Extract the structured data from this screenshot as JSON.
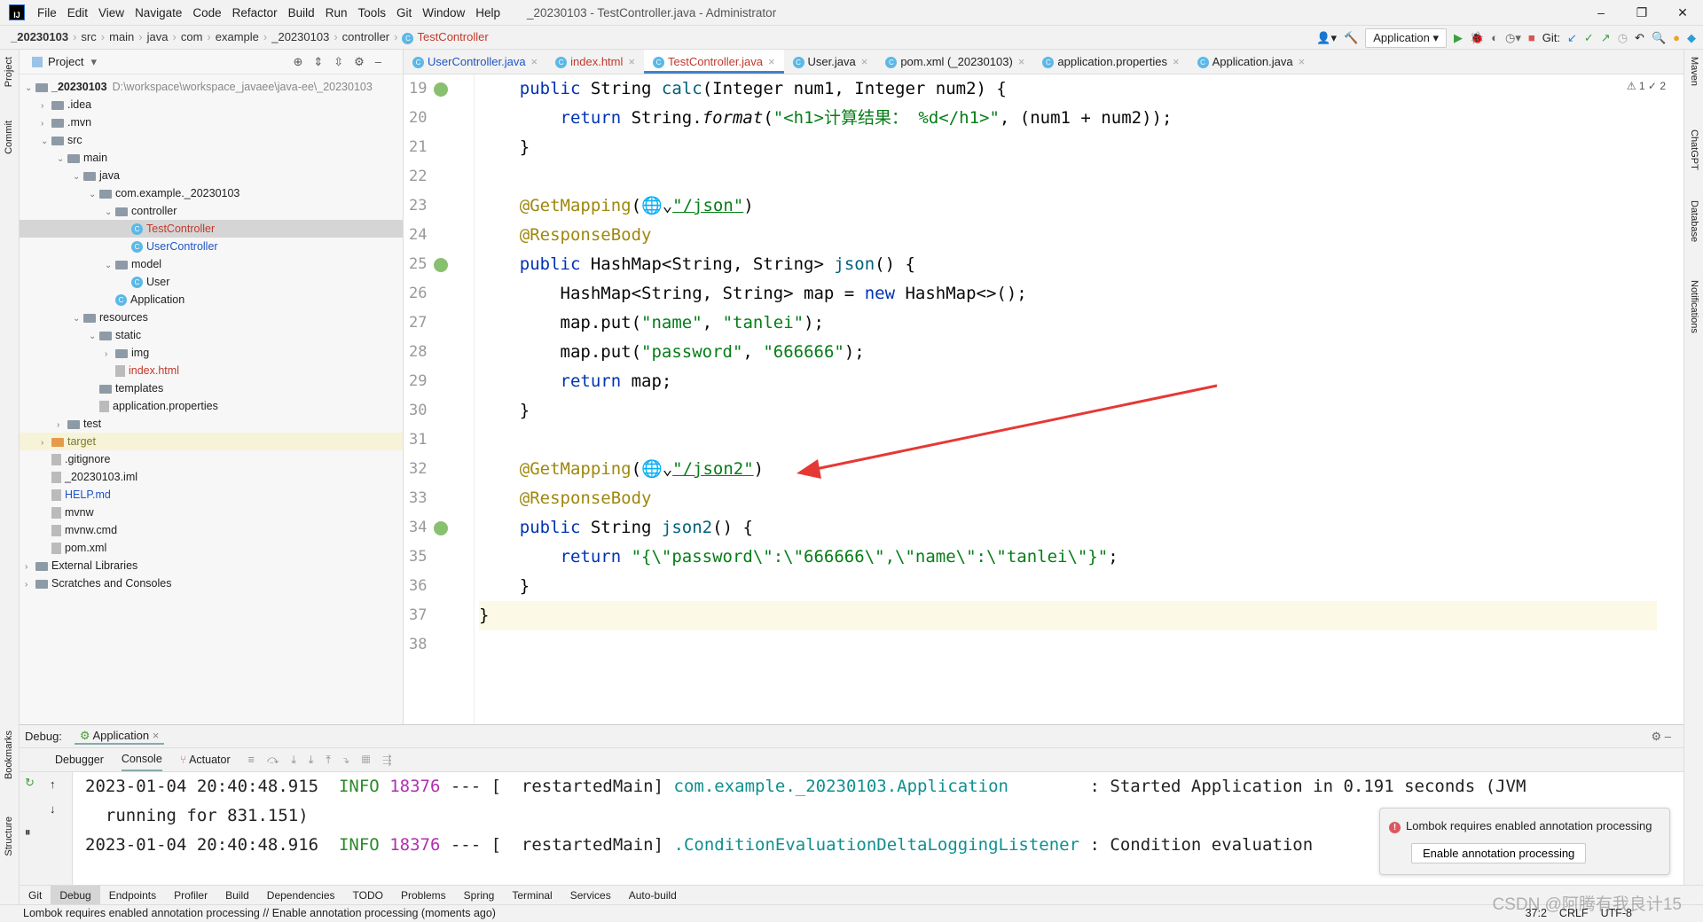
{
  "menu": [
    "File",
    "Edit",
    "View",
    "Navigate",
    "Code",
    "Refactor",
    "Build",
    "Run",
    "Tools",
    "Git",
    "Window",
    "Help"
  ],
  "window_title": "_20230103 - TestController.java - Administrator",
  "breadcrumb": [
    "_20230103",
    "src",
    "main",
    "java",
    "com",
    "example",
    "_20230103",
    "controller",
    "TestController"
  ],
  "toolbar": {
    "run_config": "Application",
    "git_label": "Git:"
  },
  "project": {
    "title": "Project",
    "tree": [
      {
        "d": 0,
        "a": "v",
        "t": "_20230103",
        "extra": "D:\\workspace\\workspace_javaee\\java-ee\\_20230103",
        "k": "folder",
        "b": true
      },
      {
        "d": 1,
        "a": ">",
        "t": ".idea",
        "k": "folder"
      },
      {
        "d": 1,
        "a": ">",
        "t": ".mvn",
        "k": "folder"
      },
      {
        "d": 1,
        "a": "v",
        "t": "src",
        "k": "folder"
      },
      {
        "d": 2,
        "a": "v",
        "t": "main",
        "k": "folder"
      },
      {
        "d": 3,
        "a": "v",
        "t": "java",
        "k": "folder"
      },
      {
        "d": 4,
        "a": "v",
        "t": "com.example._20230103",
        "k": "folder"
      },
      {
        "d": 5,
        "a": "v",
        "t": "controller",
        "k": "folder"
      },
      {
        "d": 6,
        "a": "",
        "t": "TestController",
        "k": "class",
        "c": "red",
        "sel": true
      },
      {
        "d": 6,
        "a": "",
        "t": "UserController",
        "k": "class",
        "c": "blue"
      },
      {
        "d": 5,
        "a": "v",
        "t": "model",
        "k": "folder"
      },
      {
        "d": 6,
        "a": "",
        "t": "User",
        "k": "class"
      },
      {
        "d": 5,
        "a": "",
        "t": "Application",
        "k": "class"
      },
      {
        "d": 3,
        "a": "v",
        "t": "resources",
        "k": "folder"
      },
      {
        "d": 4,
        "a": "v",
        "t": "static",
        "k": "folder"
      },
      {
        "d": 5,
        "a": ">",
        "t": "img",
        "k": "folder"
      },
      {
        "d": 5,
        "a": "",
        "t": "index.html",
        "k": "file",
        "c": "red"
      },
      {
        "d": 4,
        "a": "",
        "t": "templates",
        "k": "folder"
      },
      {
        "d": 4,
        "a": "",
        "t": "application.properties",
        "k": "file"
      },
      {
        "d": 2,
        "a": ">",
        "t": "test",
        "k": "folder"
      },
      {
        "d": 1,
        "a": ">",
        "t": "target",
        "k": "ofolder",
        "c": "olive",
        "tgt": true
      },
      {
        "d": 1,
        "a": "",
        "t": ".gitignore",
        "k": "file"
      },
      {
        "d": 1,
        "a": "",
        "t": "_20230103.iml",
        "k": "file"
      },
      {
        "d": 1,
        "a": "",
        "t": "HELP.md",
        "k": "file",
        "c": "blue"
      },
      {
        "d": 1,
        "a": "",
        "t": "mvnw",
        "k": "file"
      },
      {
        "d": 1,
        "a": "",
        "t": "mvnw.cmd",
        "k": "file"
      },
      {
        "d": 1,
        "a": "",
        "t": "pom.xml",
        "k": "file"
      },
      {
        "d": 0,
        "a": ">",
        "t": "External Libraries",
        "k": "lib"
      },
      {
        "d": 0,
        "a": ">",
        "t": "Scratches and Consoles",
        "k": "lib"
      }
    ]
  },
  "tabs": [
    {
      "t": "UserController.java",
      "c": "blue"
    },
    {
      "t": "index.html",
      "c": "red"
    },
    {
      "t": "TestController.java",
      "c": "red",
      "active": true
    },
    {
      "t": "User.java"
    },
    {
      "t": "pom.xml (_20230103)"
    },
    {
      "t": "application.properties"
    },
    {
      "t": "Application.java"
    }
  ],
  "editor_info": "⚠ 1  ✓ 2",
  "code": [
    {
      "n": 19,
      "g": true,
      "tk": [
        [
          "",
          "    "
        ],
        [
          "kw",
          "public "
        ],
        [
          "",
          "String "
        ],
        [
          "fn",
          "calc"
        ],
        [
          "",
          "(Integer num1, Integer num2) {"
        ]
      ]
    },
    {
      "n": 20,
      "tk": [
        [
          "",
          "        "
        ],
        [
          "kw",
          "return "
        ],
        [
          "",
          "String."
        ],
        [
          "it",
          "format"
        ],
        [
          "",
          "("
        ],
        [
          "str",
          "\"<h1>计算结果： %d</h1>\""
        ],
        [
          "",
          ", (num1 + num2));"
        ]
      ]
    },
    {
      "n": 21,
      "tk": [
        [
          "",
          "    }"
        ]
      ]
    },
    {
      "n": 22,
      "tk": []
    },
    {
      "n": 23,
      "tk": [
        [
          "ann",
          "    @GetMapping"
        ],
        [
          "",
          "(🌐⌄"
        ],
        [
          "str ul",
          "\"/json\""
        ],
        [
          "",
          ")"
        ]
      ]
    },
    {
      "n": 24,
      "tk": [
        [
          "ann",
          "    @ResponseBody"
        ]
      ]
    },
    {
      "n": 25,
      "g": true,
      "tk": [
        [
          "",
          "    "
        ],
        [
          "kw",
          "public "
        ],
        [
          "",
          "HashMap<String, String> "
        ],
        [
          "fn",
          "json"
        ],
        [
          "",
          "() {"
        ]
      ]
    },
    {
      "n": 26,
      "tk": [
        [
          "",
          "        HashMap<String, String> map = "
        ],
        [
          "kw",
          "new "
        ],
        [
          "",
          "HashMap<>();"
        ]
      ]
    },
    {
      "n": 27,
      "tk": [
        [
          "",
          "        map.put("
        ],
        [
          "str",
          "\"name\""
        ],
        [
          "",
          ", "
        ],
        [
          "str",
          "\"tanlei\""
        ],
        [
          "",
          ");"
        ]
      ]
    },
    {
      "n": 28,
      "tk": [
        [
          "",
          "        map.put("
        ],
        [
          "str",
          "\"password\""
        ],
        [
          "",
          ", "
        ],
        [
          "str",
          "\"666666\""
        ],
        [
          "",
          ");"
        ]
      ]
    },
    {
      "n": 29,
      "tk": [
        [
          "",
          "        "
        ],
        [
          "kw",
          "return "
        ],
        [
          "",
          "map;"
        ]
      ]
    },
    {
      "n": 30,
      "tk": [
        [
          "",
          "    }"
        ]
      ]
    },
    {
      "n": 31,
      "tk": []
    },
    {
      "n": 32,
      "tk": [
        [
          "ann",
          "    @GetMapping"
        ],
        [
          "",
          "(🌐⌄"
        ],
        [
          "str ul",
          "\"/json2\""
        ],
        [
          "",
          ")"
        ]
      ]
    },
    {
      "n": 33,
      "tk": [
        [
          "ann",
          "    @ResponseBody"
        ]
      ]
    },
    {
      "n": 34,
      "g": true,
      "tk": [
        [
          "",
          "    "
        ],
        [
          "kw",
          "public "
        ],
        [
          "",
          "String "
        ],
        [
          "fn",
          "json2"
        ],
        [
          "",
          "() {"
        ]
      ]
    },
    {
      "n": 35,
      "tk": [
        [
          "",
          "        "
        ],
        [
          "kw",
          "return "
        ],
        [
          "str",
          "\"{\\\"password\\\":\\\"666666\\\",\\\"name\\\":\\\"tanlei\\\"}\""
        ],
        [
          "",
          ";"
        ]
      ]
    },
    {
      "n": 36,
      "tk": [
        [
          "",
          "    }"
        ]
      ]
    },
    {
      "n": 37,
      "cur": true,
      "tk": [
        [
          "",
          "}"
        ]
      ]
    },
    {
      "n": 38,
      "tk": []
    }
  ],
  "debug": {
    "label": "Debug:",
    "session": "Application",
    "tabs": [
      "Debugger",
      "Console",
      "Actuator"
    ],
    "console": [
      [
        [
          "",
          "2023-01-04 20:40:48.915  "
        ],
        [
          "info",
          "INFO "
        ],
        [
          "pid",
          "18376"
        ],
        [
          "",
          " --- [  restartedMain] "
        ],
        [
          "cls",
          "com.example._20230103.Application       "
        ],
        [
          "",
          " : Started Application in 0.191 seconds (JVM"
        ]
      ],
      [
        [
          "",
          "  running for 831.151)"
        ]
      ],
      [
        [
          "",
          "2023-01-04 20:40:48.916  "
        ],
        [
          "info",
          "INFO "
        ],
        [
          "pid",
          "18376"
        ],
        [
          "",
          " --- [  restartedMain] "
        ],
        [
          "cls",
          ".ConditionEvaluationDeltaLoggingListener"
        ],
        [
          "",
          " : Condition evaluation"
        ]
      ]
    ]
  },
  "notification": {
    "message": "Lombok requires enabled annotation processing",
    "button": "Enable annotation processing"
  },
  "bottom_tools": [
    "Git",
    "Debug",
    "Endpoints",
    "Profiler",
    "Build",
    "Dependencies",
    "TODO",
    "Problems",
    "Spring",
    "Terminal",
    "Services",
    "Auto-build"
  ],
  "left_stripe": [
    "Project",
    "Commit",
    "Bookmarks",
    "Structure"
  ],
  "right_stripe": [
    "Maven",
    "ChatGPT",
    "Database",
    "Notifications"
  ],
  "status": {
    "message": "Lombok requires enabled annotation processing // Enable annotation processing (moments ago)",
    "position": "37:2",
    "line_sep": "CRLF",
    "encoding": "UTF-8",
    "watermark": "CSDN @阿腾有我良计15"
  },
  "colors": {
    "accent": "#4083c9",
    "annotation_arrow": "#e53935"
  }
}
